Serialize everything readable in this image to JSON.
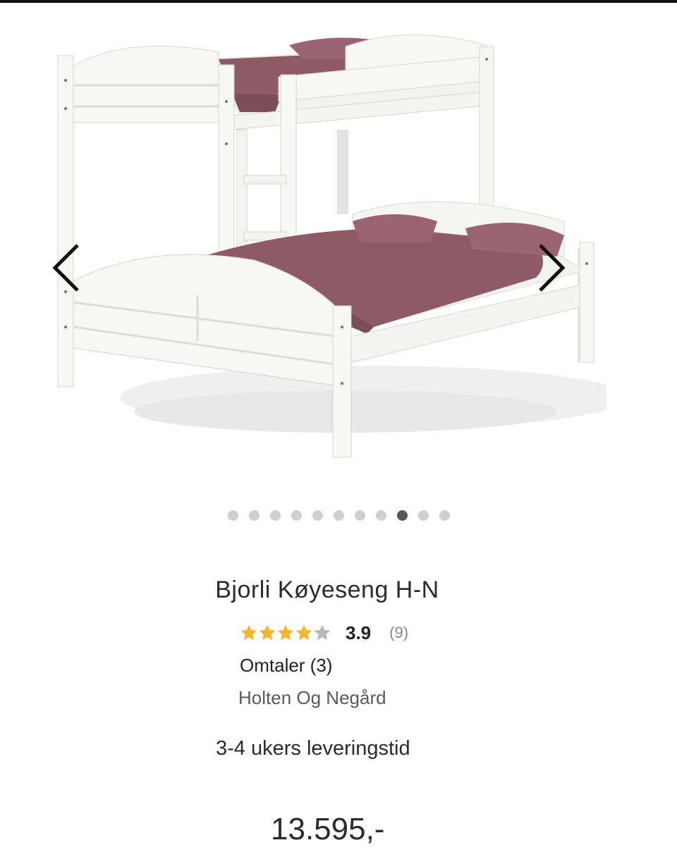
{
  "product": {
    "title": "Bjorli Køyeseng H-N",
    "rating_value": "3.9",
    "rating": 3.9,
    "rating_max": 5,
    "rating_count": "(9)",
    "reviews_label": "Omtaler (3)",
    "brand": "Holten Og Negård",
    "delivery": "3-4 ukers leveringstid",
    "price": "13.595,-"
  },
  "gallery": {
    "image_count": 11,
    "active_index": 8,
    "prev_icon": "chevron-left-icon",
    "next_icon": "chevron-right-icon"
  },
  "colors": {
    "star_filled": "#f5b62b",
    "star_empty": "#b9b9b9",
    "dot_active": "#555555",
    "dot_inactive": "#cfcfcf",
    "bedding": "#8e5a66",
    "frame": "#f7f7f5"
  }
}
